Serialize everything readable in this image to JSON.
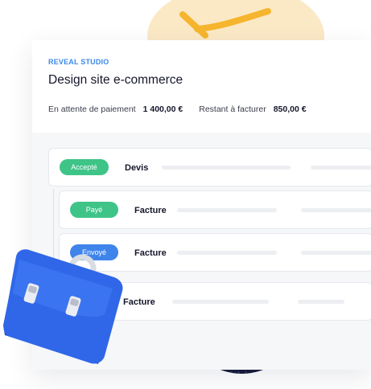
{
  "header": {
    "studio": "REVEAL STUDIO",
    "title": "Design site e-commerce"
  },
  "stats": {
    "pending_label": "En attente de paiement",
    "pending_value": "1 400,00 €",
    "remaining_label": "Restant à facturer",
    "remaining_value": "850,00 €"
  },
  "documents": [
    {
      "status": "Accepté",
      "name": "Devis",
      "status_color": "#3ec487"
    },
    {
      "status": "Payé",
      "name": "Facture",
      "status_color": "#3ec487"
    },
    {
      "status": "Envoyé",
      "name": "Facture",
      "status_color": "#3f84ea"
    },
    {
      "status": "",
      "name": "Facture",
      "status_color": ""
    }
  ],
  "decor": {
    "icon": "briefcase-icon",
    "accent_yellow": "#f6b52e",
    "briefcase_blue": "#2f67e8"
  }
}
